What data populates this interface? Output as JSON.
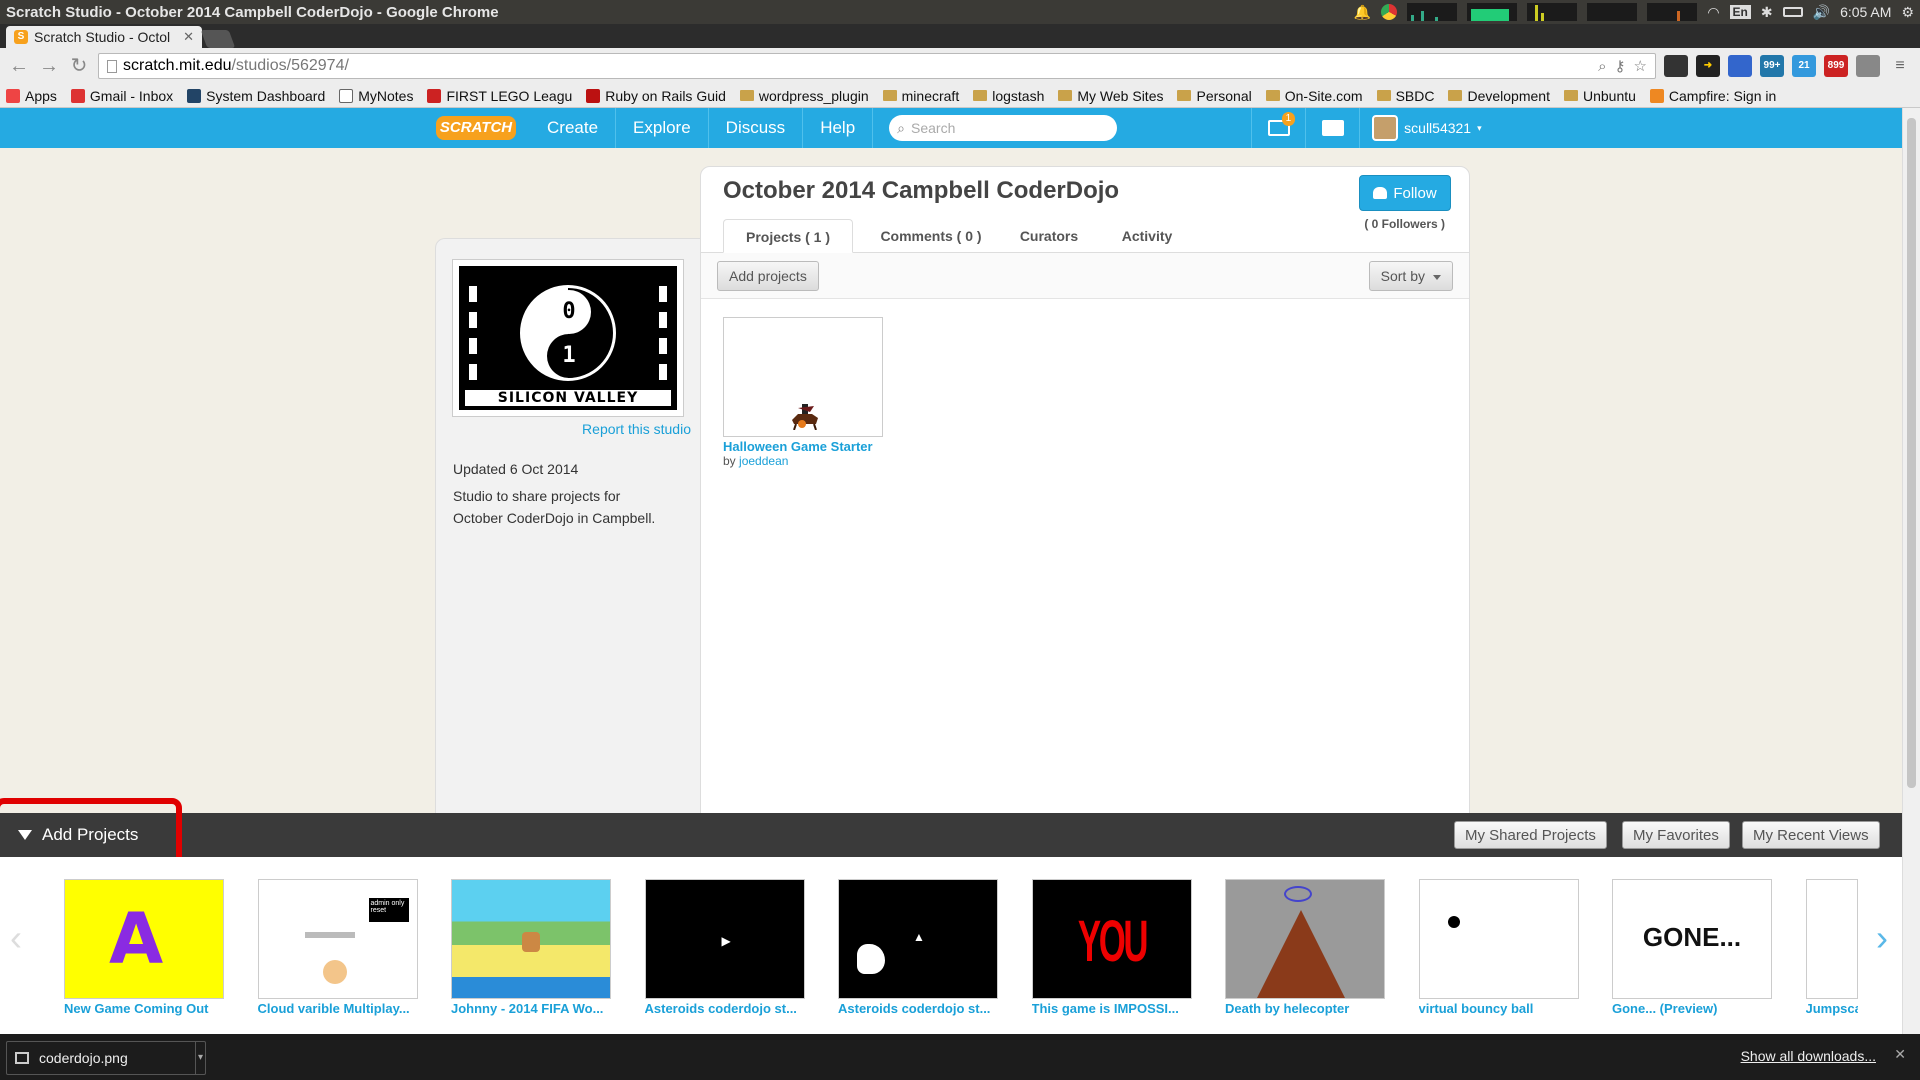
{
  "os": {
    "window_title": "Scratch Studio - October 2014 Campbell CoderDojo - Google Chrome",
    "time": "6:05 AM",
    "keyboard": "En"
  },
  "browser": {
    "tab_title": "Scratch Studio - Octol",
    "url_host": "scratch.mit.edu",
    "url_path": "/studios/562974/",
    "extension_badges": [
      "99+",
      "21",
      "899"
    ],
    "bookmarks": [
      {
        "label": "Apps",
        "icon": "apps-icon"
      },
      {
        "label": "Gmail - Inbox",
        "icon": "gmail-icon"
      },
      {
        "label": "System Dashboard",
        "icon": "dashboard-icon"
      },
      {
        "label": "MyNotes",
        "icon": "page-icon"
      },
      {
        "label": "FIRST LEGO Leagu",
        "icon": "fll-icon"
      },
      {
        "label": "Ruby on Rails Guid",
        "icon": "rails-icon"
      },
      {
        "label": "wordpress_plugin",
        "icon": "folder-icon"
      },
      {
        "label": "minecraft",
        "icon": "folder-icon"
      },
      {
        "label": "logstash",
        "icon": "folder-icon"
      },
      {
        "label": "My Web Sites",
        "icon": "folder-icon"
      },
      {
        "label": "Personal",
        "icon": "folder-icon"
      },
      {
        "label": "On-Site.com",
        "icon": "folder-icon"
      },
      {
        "label": "SBDC",
        "icon": "folder-icon"
      },
      {
        "label": "Development",
        "icon": "folder-icon"
      },
      {
        "label": "Unbuntu",
        "icon": "folder-icon"
      },
      {
        "label": "Campfire: Sign in",
        "icon": "campfire-icon"
      }
    ]
  },
  "scratch_header": {
    "logo": "SCRATCH",
    "nav": [
      "Create",
      "Explore",
      "Discuss",
      "Help"
    ],
    "search_placeholder": "Search",
    "messages_badge": "1",
    "username": "scull54321"
  },
  "studio": {
    "title": "October 2014 Campbell CoderDojo",
    "follow_label": "Follow",
    "followers": "( 0 Followers )",
    "thumbnail_caption": "SILICON VALLEY",
    "thumbnail_digits": [
      "0",
      "1"
    ],
    "report_label": "Report this studio",
    "updated": "Updated 6 Oct 2014",
    "description": "Studio to share projects for October CoderDojo in Campbell.",
    "tabs": [
      "Projects ( 1 )",
      "Comments ( 0 )",
      "Curators",
      "Activity"
    ],
    "add_projects_btn": "Add projects",
    "sort_by_btn": "Sort by",
    "projects": [
      {
        "title": "Halloween Game Starter",
        "by_prefix": "by",
        "author": "joeddean"
      }
    ]
  },
  "tray": {
    "toggle_label": "Add Projects",
    "tabs": [
      "My Shared Projects",
      "My Favorites",
      "My Recent Views"
    ],
    "items": [
      {
        "title": "New Game Coming Out",
        "thumb_text": "A"
      },
      {
        "title": "Cloud varible Multiplay...",
        "thumb_text": "admin only reset"
      },
      {
        "title": "Johnny - 2014 FIFA Wo...",
        "thumb_text": ""
      },
      {
        "title": "Asteroids coderdojo st...",
        "thumb_text": ""
      },
      {
        "title": "Asteroids coderdojo st...",
        "thumb_text": ""
      },
      {
        "title": "This game is IMPOSSI...",
        "thumb_text": "YOU LOSE"
      },
      {
        "title": "Death by helecopter",
        "thumb_text": ""
      },
      {
        "title": "virtual bouncy ball",
        "thumb_text": ""
      },
      {
        "title": "Gone... (Preview)",
        "thumb_text": "GONE..."
      },
      {
        "title": "Jumpsca",
        "thumb_text": ""
      }
    ]
  },
  "downloads": {
    "file": "coderdojo.png",
    "show_all": "Show all downloads..."
  }
}
